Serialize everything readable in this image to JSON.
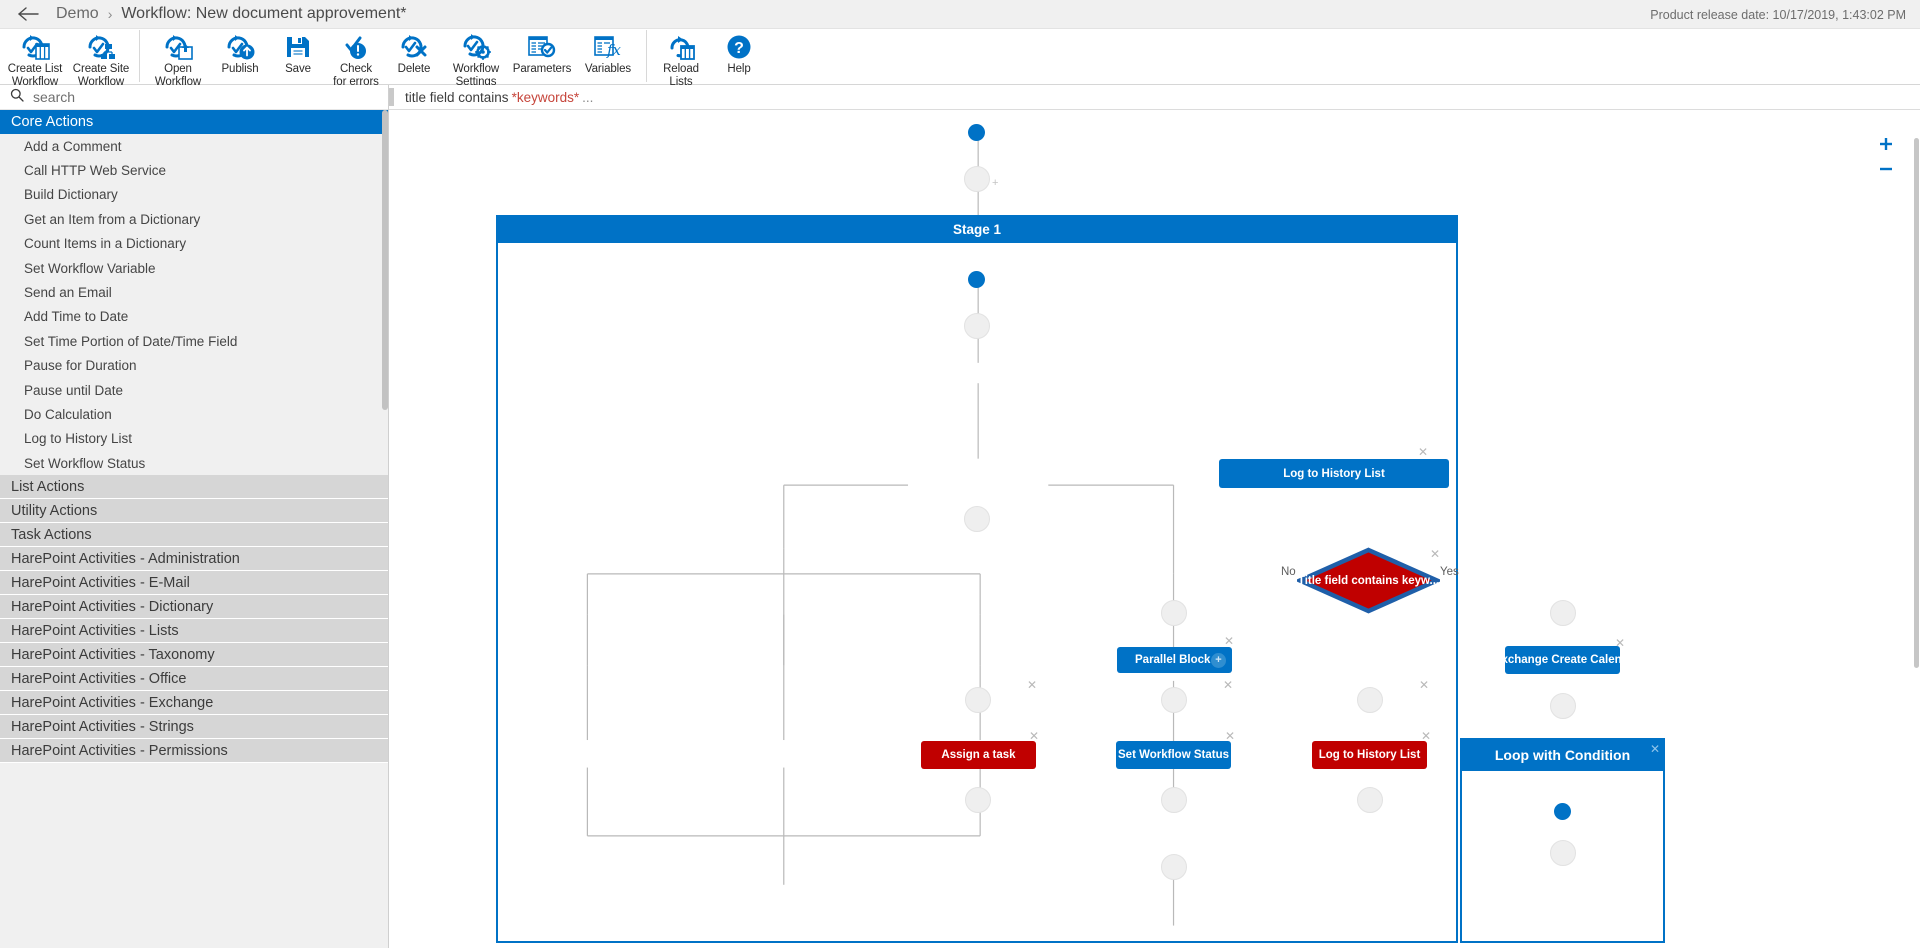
{
  "titlebar": {
    "back_label": "back-arrow",
    "breadcrumb": {
      "root": "Demo",
      "separator": "›",
      "current": "Workflow: New document approvement*"
    },
    "release_info": "Product release date: 10/17/2019, 1:43:02 PM"
  },
  "ribbon": {
    "groups": [
      {
        "buttons": [
          {
            "label": "Create List\nWorkflow",
            "icon": "create-list-workflow-icon"
          },
          {
            "label": "Create Site\nWorkflow",
            "icon": "create-site-workflow-icon"
          }
        ]
      },
      {
        "buttons": [
          {
            "label": "Open\nWorkflow",
            "icon": "open-workflow-icon"
          },
          {
            "label": "Publish",
            "icon": "publish-icon"
          },
          {
            "label": "Save",
            "icon": "save-icon"
          },
          {
            "label": "Check\nfor errors",
            "icon": "check-for-errors-icon"
          },
          {
            "label": "Delete",
            "icon": "delete-icon"
          },
          {
            "label": "Workflow\nSettings",
            "icon": "workflow-settings-icon"
          },
          {
            "label": "Parameters",
            "icon": "parameters-icon"
          },
          {
            "label": "Variables",
            "icon": "variables-icon"
          }
        ]
      },
      {
        "buttons": [
          {
            "label": "Reload\nLists",
            "icon": "reload-lists-icon"
          },
          {
            "label": "Help",
            "icon": "help-icon"
          }
        ]
      }
    ]
  },
  "sidebar": {
    "search": {
      "placeholder": "search",
      "value": "",
      "icon": "search-icon"
    },
    "groups": [
      {
        "label": "Core Actions",
        "active": true,
        "items": [
          "Add a Comment",
          "Call HTTP Web Service",
          "Build Dictionary",
          "Get an Item from a Dictionary",
          "Count Items in a Dictionary",
          "Set Workflow Variable",
          "Send an Email",
          "Add Time to Date",
          "Set Time Portion of Date/Time Field",
          "Pause for Duration",
          "Pause until Date",
          "Do Calculation",
          "Log to History List",
          "Set Workflow Status"
        ]
      },
      {
        "label": "List Actions",
        "active": false,
        "items": []
      },
      {
        "label": "Utility Actions",
        "active": false,
        "items": []
      },
      {
        "label": "Task Actions",
        "active": false,
        "items": []
      },
      {
        "label": "HarePoint Activities - Administration",
        "active": false,
        "items": []
      },
      {
        "label": "HarePoint Activities - E-Mail",
        "active": false,
        "items": []
      },
      {
        "label": "HarePoint Activities - Dictionary",
        "active": false,
        "items": []
      },
      {
        "label": "HarePoint Activities - Lists",
        "active": false,
        "items": []
      },
      {
        "label": "HarePoint Activities - Taxonomy",
        "active": false,
        "items": []
      },
      {
        "label": "HarePoint Activities - Office",
        "active": false,
        "items": []
      },
      {
        "label": "HarePoint Activities - Exchange",
        "active": false,
        "items": []
      },
      {
        "label": "HarePoint Activities - Strings",
        "active": false,
        "items": []
      },
      {
        "label": "HarePoint Activities - Permissions",
        "active": false,
        "items": []
      }
    ]
  },
  "context_bar": {
    "prefix": "title field contains",
    "highlight": "*keywords*",
    "suffix": "..."
  },
  "zoom_controls": {
    "zoom_in": "+",
    "zoom_out": "−"
  },
  "workflow": {
    "stage": {
      "title": "Stage 1"
    },
    "nodes": {
      "log_history_top": "Log to History List",
      "condition": "Title field contains keyw...",
      "branch_no": "No",
      "branch_yes": "Yes",
      "parallel_block": "Parallel Block",
      "assign_task": "Assign a task",
      "set_workflow_status": "Set Workflow Status",
      "log_history_bottom": "Log to History List",
      "exchange_create": "Exchange Create Calen...",
      "loop_with_condition": "Loop with Condition"
    },
    "colors": {
      "blue": "#0072c6",
      "red": "#c00000",
      "diamond_border": "#1f5fa9"
    }
  }
}
